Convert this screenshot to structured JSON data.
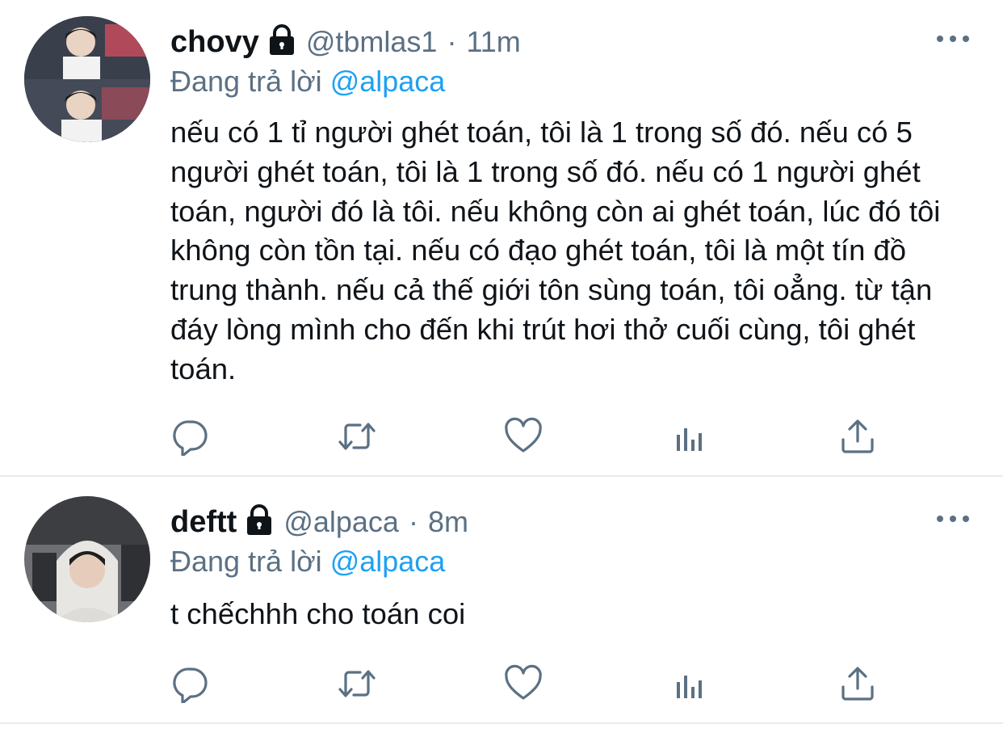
{
  "tweets": [
    {
      "display_name": "chovy",
      "handle": "@tbmlas1",
      "separator": "·",
      "time": "11m",
      "reply_prefix": "Đang trả lời",
      "reply_to": "@alpaca",
      "text": "nếu có 1 tỉ người ghét toán, tôi là 1 trong số đó. nếu có 5 người ghét toán, tôi là 1 trong số đó. nếu có 1 người ghét toán, người đó là tôi. nếu không còn ai ghét toán, lúc đó tôi không còn tồn tại. nếu có đạo ghét toán, tôi là một tín đồ trung thành. nếu cả thế giới tôn sùng toán, tôi oẳng. từ tận đáy lòng mình cho đến khi trút hơi thở cuối cùng, tôi ghét toán.",
      "protected_icon": "lock-icon"
    },
    {
      "display_name": "deftt",
      "handle": "@alpaca",
      "separator": "·",
      "time": "8m",
      "reply_prefix": "Đang trả lời",
      "reply_to": "@alpaca",
      "text": "t chếchhh cho toán coi",
      "protected_icon": "lock-icon"
    }
  ],
  "action_icons": [
    "reply-icon",
    "retweet-icon",
    "like-icon",
    "analytics-icon",
    "share-icon"
  ],
  "colors": {
    "text": "#0f1419",
    "secondary": "#5b7083",
    "link": "#1da1f2",
    "divider": "#e6ecf0"
  }
}
